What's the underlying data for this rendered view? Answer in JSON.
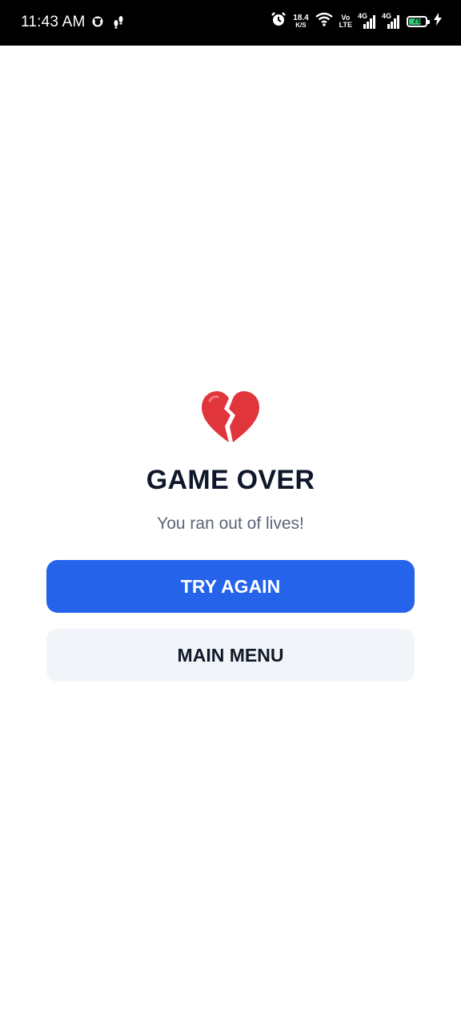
{
  "status_bar": {
    "time": "11:43 AM",
    "net_speed_value": "18.4",
    "net_speed_unit": "K/S",
    "volte_top": "Vo",
    "volte_bottom": "LTE",
    "sim1_label": "4G",
    "sim2_label": "4G",
    "battery_level": "75",
    "battery_fraction": 0.75,
    "icons": [
      "notification-app-icon",
      "step-counter-icon",
      "alarm-icon",
      "wifi-icon",
      "signal-icon",
      "battery-icon",
      "charging-icon"
    ]
  },
  "game_over": {
    "icon": "broken-heart-icon",
    "title": "GAME OVER",
    "message": "You ran out of lives!",
    "try_again_label": "TRY AGAIN",
    "main_menu_label": "MAIN MENU"
  },
  "colors": {
    "primary_button": "#2563eb",
    "secondary_button": "#f1f4f9",
    "title": "#0f172a",
    "subtitle": "#5b6577",
    "heart": "#e0353b"
  }
}
